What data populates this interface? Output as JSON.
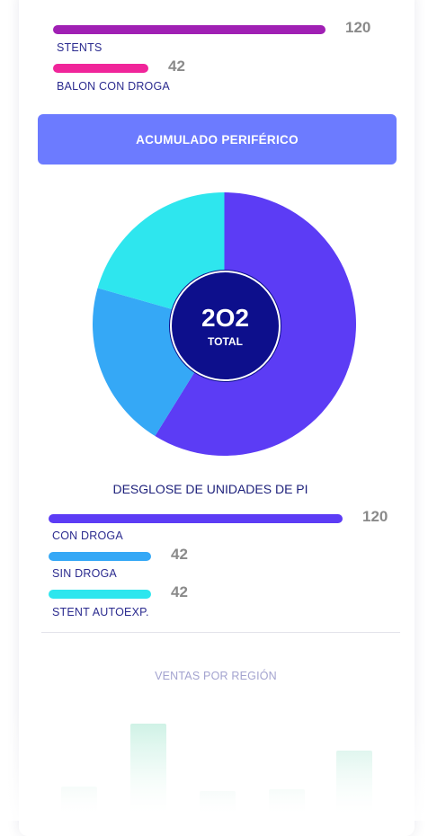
{
  "top_bars": [
    {
      "label": "STENTS",
      "value": "120",
      "fraction": 1.0,
      "color": "#a020b4"
    },
    {
      "label": "BALON CON DROGA",
      "value": "42",
      "fraction": 0.35,
      "color": "#f0259a"
    }
  ],
  "header": {
    "title": "ACUMULADO PERIFÉRICO",
    "color": "#6c7bff"
  },
  "donut": {
    "total_value": "2O2",
    "total_label": "TOTAL",
    "slices": [
      {
        "name": "CON DROGA",
        "value": 120,
        "color": "#5c3cf5"
      },
      {
        "name": "SIN DROGA",
        "value": 42,
        "color": "#35a8f6"
      },
      {
        "name": "STENT AUTOEXP.",
        "value": 42,
        "color": "#2ee6ee"
      }
    ]
  },
  "breakdown": {
    "title": "DESGLOSE DE UNIDADES DE PI",
    "bars": [
      {
        "label": "CON DROGA",
        "value": "120",
        "fraction": 1.0,
        "color": "#5c3cf5"
      },
      {
        "label": "SIN DROGA",
        "value": "42",
        "fraction": 0.35,
        "color": "#35a8f6"
      },
      {
        "label": "STENT AUTOEXP.",
        "value": "42",
        "fraction": 0.35,
        "color": "#2ee6ee"
      }
    ]
  },
  "region": {
    "title": "VENTAS POR REGIÓN",
    "bars": [
      {
        "level": 0.3,
        "color": "#eaf7f2"
      },
      {
        "level": 1.0,
        "color": "#c8f0e2"
      },
      {
        "level": 0.25,
        "color": "#eaf7f2"
      },
      {
        "level": 0.27,
        "color": "#eaf7f2"
      },
      {
        "level": 0.7,
        "color": "#d4f3e8"
      }
    ]
  }
}
